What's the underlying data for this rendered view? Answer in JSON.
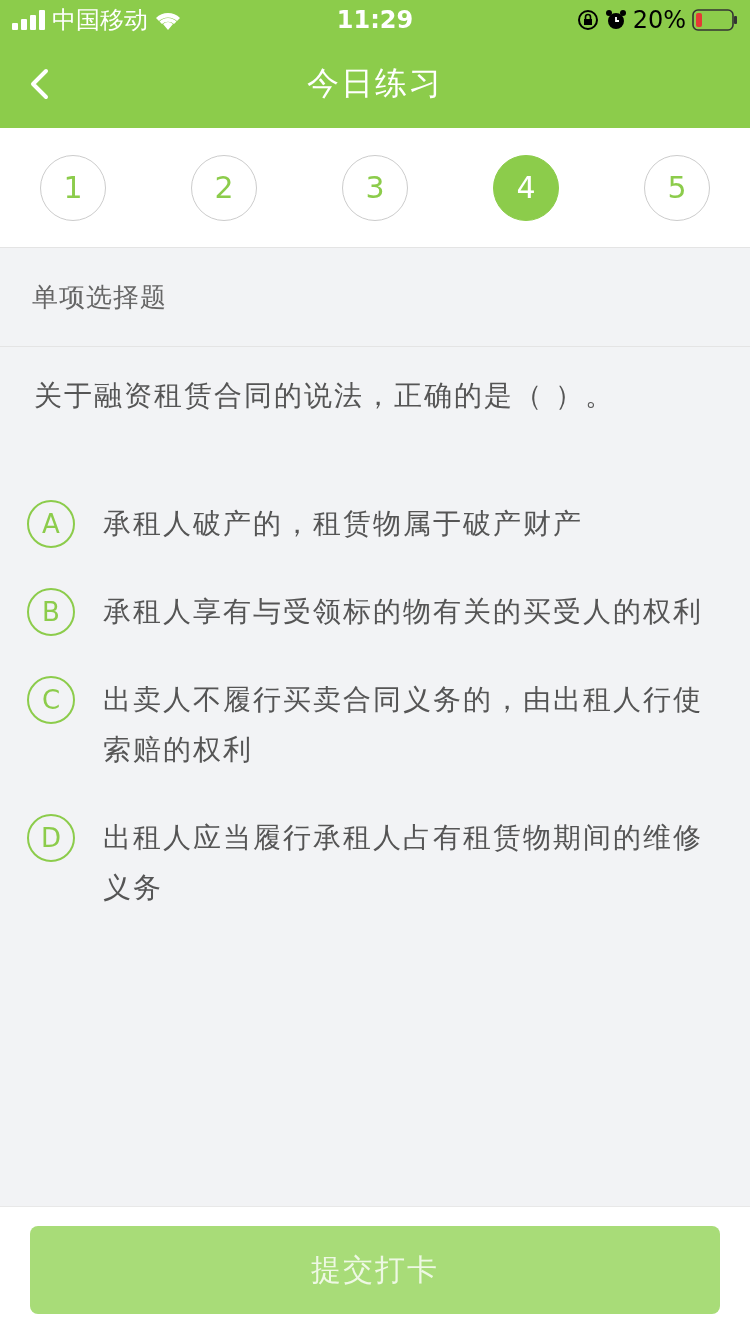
{
  "status_bar": {
    "carrier": "中国移动",
    "time": "11:29",
    "battery": "20%"
  },
  "nav": {
    "title": "今日练习"
  },
  "steps": [
    {
      "label": "1",
      "selected": false
    },
    {
      "label": "2",
      "selected": false
    },
    {
      "label": "3",
      "selected": false
    },
    {
      "label": "4",
      "selected": true
    },
    {
      "label": "5",
      "selected": false
    }
  ],
  "section": "单项选择题",
  "question": "关于融资租赁合同的说法，正确的是（   ）。",
  "options": [
    {
      "letter": "A",
      "text": "承租人破产的，租赁物属于破产财产",
      "selected": false
    },
    {
      "letter": "B",
      "text": "承租人享有与受领标的物有关的买受人的权利",
      "selected": false
    },
    {
      "letter": "C",
      "text": "出卖人不履行买卖合同义务的，由出租人行使索赔的权利",
      "selected": false
    },
    {
      "letter": "D",
      "text": "出租人应当履行承租人占有租赁物期间的维修义务",
      "selected": false
    }
  ],
  "submit": {
    "label": "提交打卡",
    "disabled": true
  }
}
